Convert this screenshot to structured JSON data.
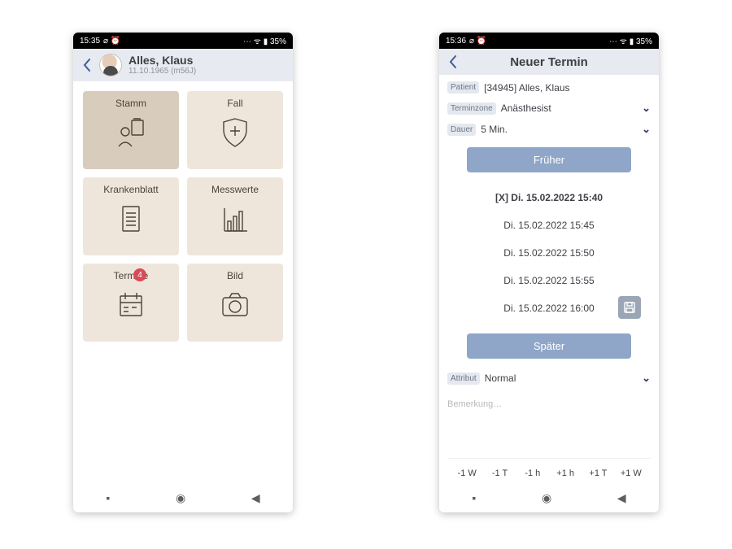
{
  "phone1": {
    "status": {
      "time": "15:35",
      "icons_left": "⌀ ⏰",
      "icons_right": "⋯ ᯤ ▮ 35%"
    },
    "header": {
      "name": "Alles, Klaus",
      "sub": "11.10.1965 (m56J)"
    },
    "tiles": [
      {
        "label": "Stamm"
      },
      {
        "label": "Fall"
      },
      {
        "label": "Krankenblatt"
      },
      {
        "label": "Messwerte"
      },
      {
        "label": "Termine",
        "badge": "4"
      },
      {
        "label": "Bild"
      }
    ]
  },
  "phone2": {
    "status": {
      "time": "15:36",
      "icons_left": "⌀ ⏰",
      "icons_right": "⋯ ᯤ ▮ 35%"
    },
    "header_title": "Neuer Termin",
    "fields": {
      "patient_label": "Patient",
      "patient_value": "[34945] Alles, Klaus",
      "zone_label": "Terminzone",
      "zone_value": "Anästhesist",
      "dauer_label": "Dauer",
      "dauer_value": "5 Min.",
      "attribut_label": "Attribut",
      "attribut_value": "Normal",
      "remark_placeholder": "Bemerkung…"
    },
    "earlier_label": "Früher",
    "later_label": "Später",
    "slots": [
      {
        "text": "[X] Di. 15.02.2022 15:40",
        "selected": true
      },
      {
        "text": "Di. 15.02.2022 15:45"
      },
      {
        "text": "Di. 15.02.2022 15:50"
      },
      {
        "text": "Di. 15.02.2022 15:55"
      },
      {
        "text": "Di. 15.02.2022 16:00",
        "action": true
      }
    ],
    "offsets": [
      "-1 W",
      "-1 T",
      "-1 h",
      "+1 h",
      "+1 T",
      "+1 W"
    ]
  }
}
